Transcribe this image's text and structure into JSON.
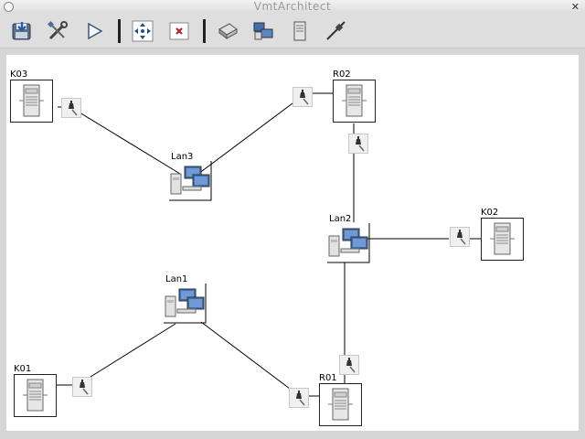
{
  "window": {
    "title": "VmtArchitect"
  },
  "toolbar": {
    "buttons": [
      {
        "name": "save-button",
        "icon": "save-disk-icon"
      },
      {
        "name": "tools-button",
        "icon": "wrench-screwdriver-icon"
      },
      {
        "name": "run-button",
        "icon": "play-icon"
      },
      {
        "name": "move-button",
        "icon": "move-arrows-icon"
      },
      {
        "name": "delete-button",
        "icon": "delete-x-icon"
      },
      {
        "name": "add-hub-button",
        "icon": "hub-icon"
      },
      {
        "name": "add-lan-button",
        "icon": "lan-computers-icon"
      },
      {
        "name": "add-server-button",
        "icon": "server-icon"
      },
      {
        "name": "add-cable-button",
        "icon": "cable-icon"
      }
    ]
  },
  "nodes": {
    "k03": {
      "label": "K03",
      "kind": "server"
    },
    "r02": {
      "label": "R02",
      "kind": "server"
    },
    "k02": {
      "label": "K02",
      "kind": "server"
    },
    "k01": {
      "label": "K01",
      "kind": "server"
    },
    "r01": {
      "label": "R01",
      "kind": "server"
    },
    "lan1": {
      "label": "Lan1",
      "kind": "lan"
    },
    "lan2": {
      "label": "Lan2",
      "kind": "lan"
    },
    "lan3": {
      "label": "Lan3",
      "kind": "lan"
    }
  },
  "colors": {
    "canvas": "#ffffff",
    "window": "#d6d6d6",
    "link": "#000000"
  }
}
